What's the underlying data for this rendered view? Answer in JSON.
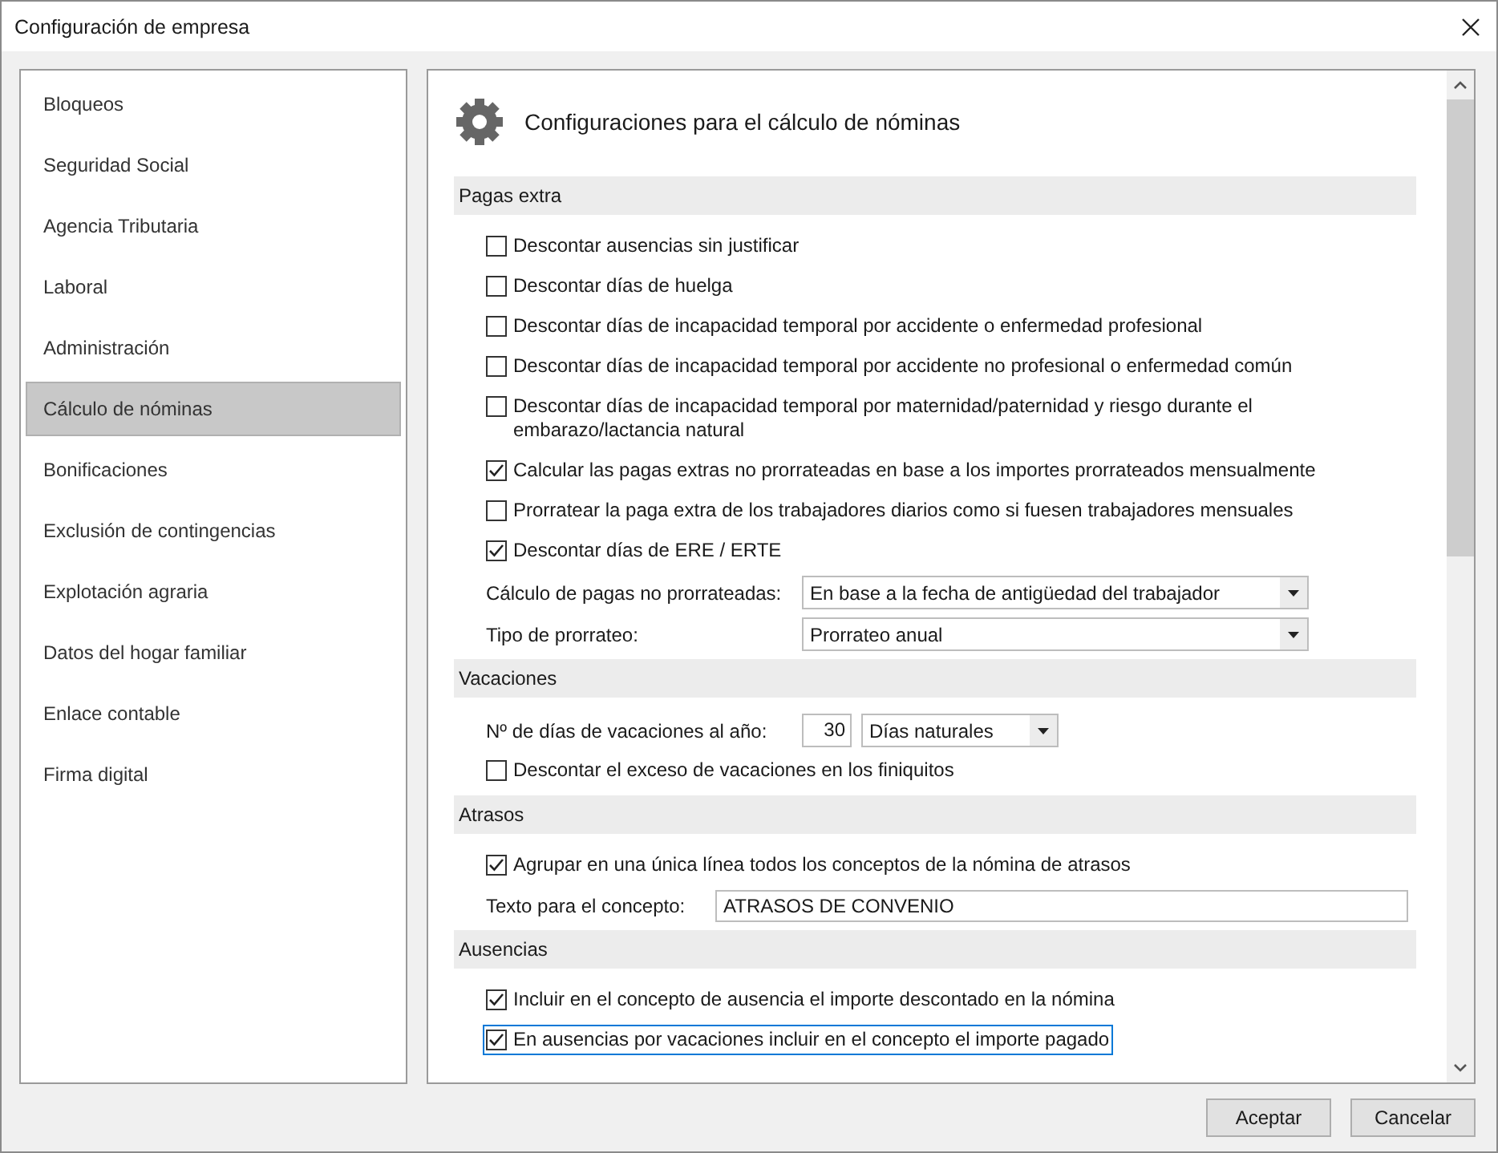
{
  "window": {
    "title": "Configuración de empresa"
  },
  "sidebar": {
    "items": [
      {
        "label": "Bloqueos",
        "selected": false
      },
      {
        "label": "Seguridad Social",
        "selected": false
      },
      {
        "label": "Agencia Tributaria",
        "selected": false
      },
      {
        "label": "Laboral",
        "selected": false
      },
      {
        "label": "Administración",
        "selected": false
      },
      {
        "label": "Cálculo de nóminas",
        "selected": true
      },
      {
        "label": "Bonificaciones",
        "selected": false
      },
      {
        "label": "Exclusión de contingencias",
        "selected": false
      },
      {
        "label": "Explotación agraria",
        "selected": false
      },
      {
        "label": "Datos del hogar familiar",
        "selected": false
      },
      {
        "label": "Enlace contable",
        "selected": false
      },
      {
        "label": "Firma digital",
        "selected": false
      }
    ]
  },
  "panel": {
    "heading": "Configuraciones para el cálculo de nóminas",
    "sections": [
      {
        "title": "Pagas extra",
        "items": [
          {
            "kind": "checkbox",
            "label": "Descontar ausencias sin justificar",
            "checked": false,
            "focused": false
          },
          {
            "kind": "checkbox",
            "label": "Descontar días de huelga",
            "checked": false,
            "focused": false
          },
          {
            "kind": "checkbox",
            "label": "Descontar días de incapacidad temporal por accidente o enfermedad profesional",
            "checked": false,
            "focused": false
          },
          {
            "kind": "checkbox",
            "label": "Descontar días de incapacidad temporal por accidente no profesional o enfermedad común",
            "checked": false,
            "focused": false
          },
          {
            "kind": "checkbox",
            "label": "Descontar días de incapacidad temporal por maternidad/paternidad y riesgo durante el embarazo/lactancia natural",
            "checked": false,
            "focused": false
          },
          {
            "kind": "checkbox",
            "label": "Calcular las pagas extras no prorrateadas en base a los importes prorrateados mensualmente",
            "checked": true,
            "focused": false
          },
          {
            "kind": "checkbox",
            "label": "Prorratear la paga extra de los trabajadores diarios como si fuesen trabajadores mensuales",
            "checked": false,
            "focused": false
          },
          {
            "kind": "checkbox",
            "label": "Descontar días de ERE / ERTE",
            "checked": true,
            "focused": false
          },
          {
            "kind": "select",
            "label": "Cálculo de pagas no prorrateadas:",
            "value": "En base a la fecha de antigüedad del trabajador"
          },
          {
            "kind": "select",
            "label": "Tipo de prorrateo:",
            "value": "Prorrateo anual"
          }
        ]
      },
      {
        "title": "Vacaciones",
        "items": [
          {
            "kind": "number",
            "label": "Nº de días de vacaciones al año:",
            "value": "30",
            "unit": "Días naturales"
          },
          {
            "kind": "checkbox",
            "label": "Descontar el exceso de vacaciones en los finiquitos",
            "checked": false,
            "focused": false
          }
        ]
      },
      {
        "title": "Atrasos",
        "items": [
          {
            "kind": "checkbox",
            "label": "Agrupar en una única línea todos los conceptos de la nómina de atrasos",
            "checked": true,
            "focused": false
          },
          {
            "kind": "text",
            "label": "Texto para el concepto:",
            "value": "ATRASOS DE CONVENIO"
          }
        ]
      },
      {
        "title": "Ausencias",
        "items": [
          {
            "kind": "checkbox",
            "label": "Incluir en el concepto de ausencia el importe descontado en la nómina",
            "checked": true,
            "focused": false
          },
          {
            "kind": "checkbox",
            "label": "En ausencias por vacaciones incluir en el concepto el importe pagado",
            "checked": true,
            "focused": true
          }
        ]
      }
    ]
  },
  "buttons": [
    "Aceptar",
    "Cancelar"
  ]
}
